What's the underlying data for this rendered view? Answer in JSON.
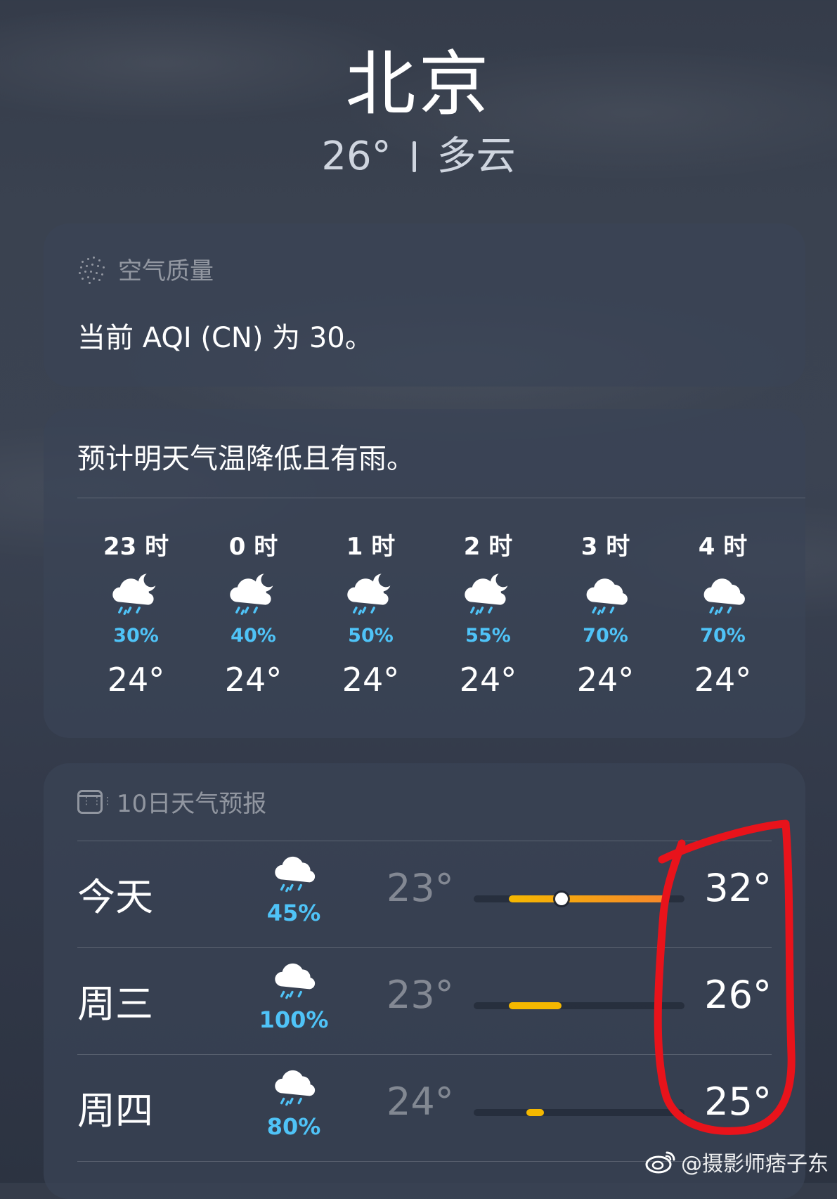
{
  "header": {
    "city": "北京",
    "temp": "26°",
    "condition": "多云"
  },
  "aqi": {
    "label": "空气质量",
    "text": "当前 AQI (CN) 为 30。"
  },
  "hourly": {
    "summary": "预计明天气温降低且有雨。",
    "hours": [
      {
        "time": "23 时",
        "icon": "partly-cloudy-night-rain-icon",
        "prob": "30%",
        "temp": "24°"
      },
      {
        "time": "0 时",
        "icon": "partly-cloudy-night-rain-icon",
        "prob": "40%",
        "temp": "24°"
      },
      {
        "time": "1 时",
        "icon": "partly-cloudy-night-rain-icon",
        "prob": "50%",
        "temp": "24°"
      },
      {
        "time": "2 时",
        "icon": "partly-cloudy-night-rain-icon",
        "prob": "55%",
        "temp": "24°"
      },
      {
        "time": "3 时",
        "icon": "rain-cloud-icon",
        "prob": "70%",
        "temp": "24°"
      },
      {
        "time": "4 时",
        "icon": "rain-cloud-icon",
        "prob": "70%",
        "temp": "24°"
      }
    ]
  },
  "daily": {
    "label": "10日天气预报",
    "range": {
      "min": 21,
      "max": 33
    },
    "days": [
      {
        "name": "今天",
        "icon": "rain-cloud-icon",
        "prob": "45%",
        "low_label": "23°",
        "high_label": "32°",
        "low": 23,
        "high": 32,
        "current": 26
      },
      {
        "name": "周三",
        "icon": "rain-cloud-icon",
        "prob": "100%",
        "low_label": "23°",
        "high_label": "26°",
        "low": 23,
        "high": 26
      },
      {
        "name": "周四",
        "icon": "rain-cloud-icon",
        "prob": "80%",
        "low_label": "24°",
        "high_label": "25°",
        "low": 24,
        "high": 25
      }
    ]
  },
  "colors": {
    "rain": "#4fc3f7",
    "bar_start": "#f5b800",
    "bar_end": "#f7872b",
    "annotation": "#e8131b"
  },
  "watermark": "@摄影师痞子东"
}
